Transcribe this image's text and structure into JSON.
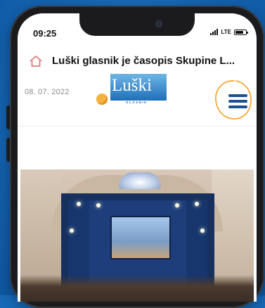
{
  "status_bar": {
    "time": "09:25",
    "network": "LTE",
    "battery_level": 0.8
  },
  "browser": {
    "page_title": "Luški glasnik je časopis Skupine L...",
    "home_icon": "home-icon"
  },
  "site_header": {
    "date": "08. 07. 2022",
    "logo_title": "Luški",
    "logo_subtitle": "GLASNIK",
    "menu_icon": "hamburger-menu-icon"
  },
  "colors": {
    "background": "#1769b7",
    "menu_icon": "#1d4f93",
    "highlight_circle": "#f2a93b",
    "home_icon": "#e07a7a"
  },
  "article": {
    "image_icon": "article-photo"
  }
}
